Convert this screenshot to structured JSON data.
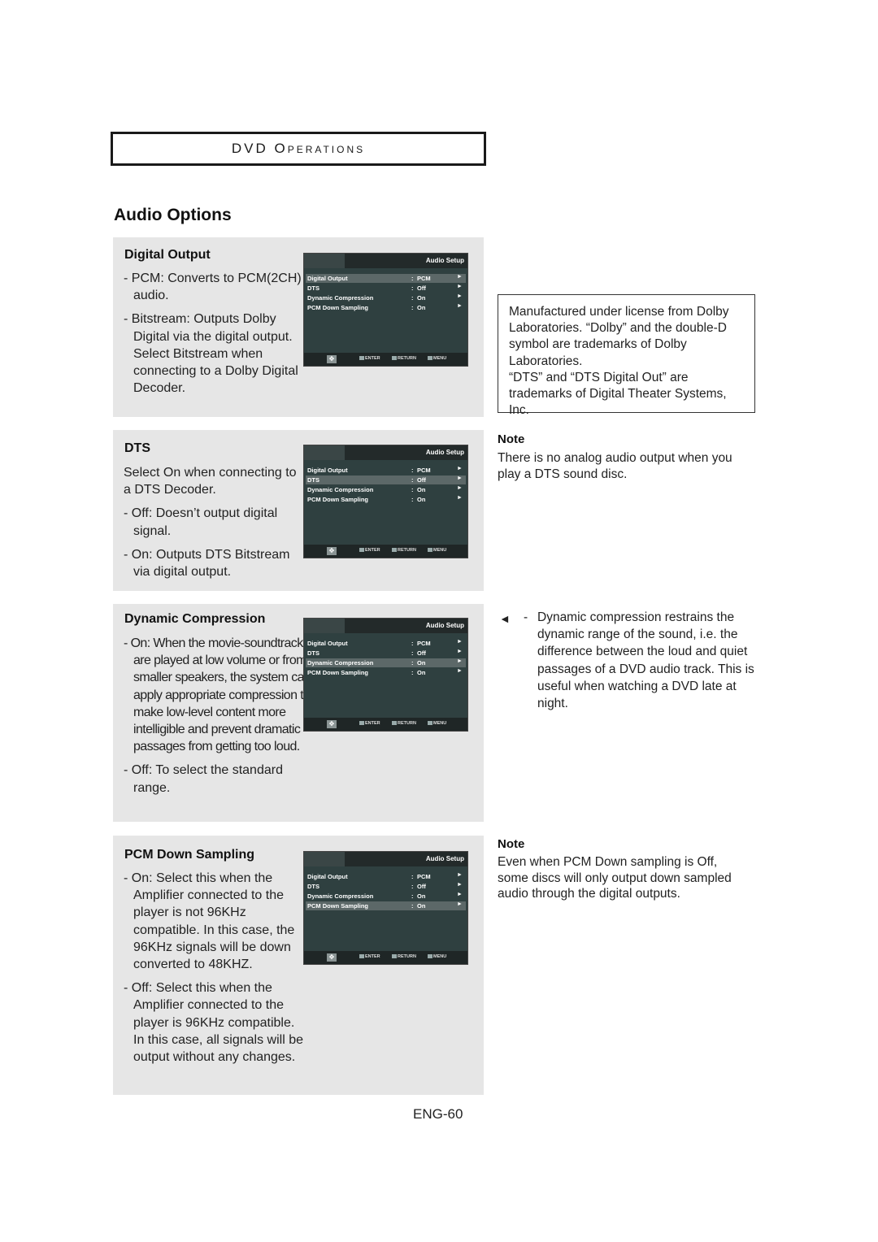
{
  "chapter": {
    "title_big": "DVD O",
    "title_small": "PERATIONS"
  },
  "page_title": "Audio Options",
  "osd": {
    "title": "Audio Setup",
    "rows": [
      {
        "label": "Digital Output",
        "value": "PCM"
      },
      {
        "label": "DTS",
        "value": "Off"
      },
      {
        "label": "Dynamic Compression",
        "value": "On"
      },
      {
        "label": "PCM Down Sampling",
        "value": "On"
      }
    ],
    "colon": ":",
    "arrow": "►",
    "footer": {
      "nav": "✥",
      "enter": "ENTER",
      "return": "RETURN",
      "menu": "MENU"
    }
  },
  "sections": [
    {
      "heading": "Digital Output",
      "selected_row": 0,
      "paragraphs": [
        "-  PCM: Converts to PCM(2CH) audio.",
        "- Bitstream: Outputs Dolby Digital via the digital output. Select Bitstream when connecting to a Dolby Digital Decoder."
      ]
    },
    {
      "heading": "DTS",
      "selected_row": 1,
      "paragraphs": [
        "Select On when connecting to a DTS Decoder.",
        "- Off: Doesn’t output digital signal.",
        "- On: Outputs DTS Bitstream via digital output."
      ]
    },
    {
      "heading": "Dynamic Compression",
      "selected_row": 2,
      "paragraphs": [
        "-  On: When the movie-soundtracks are played at low volume or from smaller speakers, the system can apply appropriate compression to make low-level content more intelligible and prevent dramatic passages from getting too loud.",
        "-  Off: To select the standard range."
      ]
    },
    {
      "heading": "PCM Down Sampling",
      "selected_row": 3,
      "paragraphs": [
        "-  On: Select this when the Amplifier connected to the player is not 96KHz compatible. In this case, the 96KHz signals will be down converted to 48KHZ.",
        "-  Off: Select this when the Amplifier connected to the player is 96KHz compatible. In this case, all signals will be output without any changes."
      ]
    }
  ],
  "license": {
    "line1": "Manufactured under license from Dolby Laboratories. “Dolby” and the double-D symbol are trademarks of Dolby Laboratories.",
    "line2": "“DTS” and “DTS Digital Out” are trademarks of Digital Theater Systems, Inc."
  },
  "notes": [
    {
      "heading": "Note",
      "text": "There is no analog audio output when you play a DTS sound disc."
    },
    {
      "heading": "Note",
      "text": "Even when PCM Down sampling is Off, some discs will only output down sampled audio through the digital outputs."
    }
  ],
  "tip": {
    "arrow": "◄",
    "dash": "-",
    "text": "Dynamic compression restrains the dynamic range of the sound, i.e. the difference between the loud and quiet passages of a DVD audio track. This is useful when watching a DVD late at night."
  },
  "page_number": "ENG-60"
}
